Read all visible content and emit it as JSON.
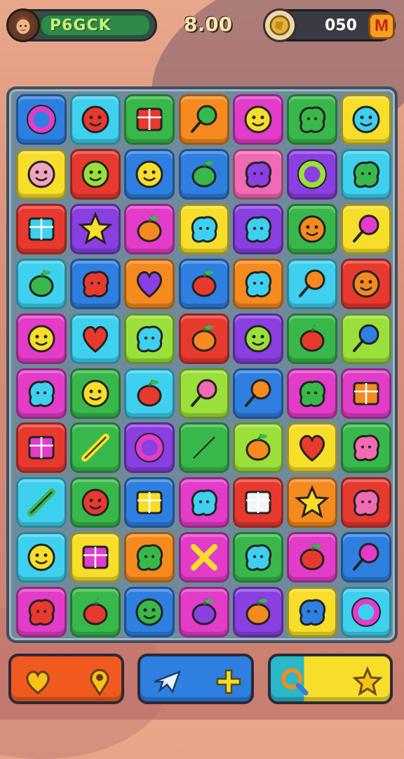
{
  "hud": {
    "player_name": "P6GCK",
    "timer": "8.00",
    "coins": "050",
    "badge_letter": "M"
  },
  "colors": {
    "red": "#e8392f",
    "orange": "#f58a1f",
    "yellow": "#f6de2a",
    "lime": "#9be03a",
    "green": "#38b84a",
    "cyan": "#3ed0ee",
    "blue": "#2e7fe0",
    "purple": "#8a3fe0",
    "magenta": "#e23cc8",
    "pink": "#f06ab4",
    "teal": "#2ab7a9"
  },
  "board": {
    "rows": [
      [
        {
          "bg": "blue",
          "icon": "donut-icon",
          "ic": "#e23cc8"
        },
        {
          "bg": "cyan",
          "icon": "spiky-monster-icon",
          "ic": "#e8392f"
        },
        {
          "bg": "green",
          "icon": "box-icon",
          "ic": "#e8392f"
        },
        {
          "bg": "orange",
          "icon": "lollipop-icon",
          "ic": "#38b84a"
        },
        {
          "bg": "magenta",
          "icon": "cat-face-icon",
          "ic": "#f6de2a"
        },
        {
          "bg": "green",
          "icon": "bush-icon",
          "ic": "#38b84a"
        },
        {
          "bg": "yellow",
          "icon": "blue-critter-icon",
          "ic": "#3ed0ee"
        }
      ],
      [
        {
          "bg": "yellow",
          "icon": "pink-face-icon",
          "ic": "#f3a3c0"
        },
        {
          "bg": "red",
          "icon": "smiley-icon",
          "ic": "#9be03a"
        },
        {
          "bg": "blue",
          "icon": "sun-face-icon",
          "ic": "#f6de2a"
        },
        {
          "bg": "blue",
          "icon": "cucumber-icon",
          "ic": "#38b84a"
        },
        {
          "bg": "pink",
          "icon": "bird-icon",
          "ic": "#8a3fe0"
        },
        {
          "bg": "purple",
          "icon": "ring-icon",
          "ic": "#9be03a"
        },
        {
          "bg": "cyan",
          "icon": "green-blob-icon",
          "ic": "#38b84a"
        }
      ],
      [
        {
          "bg": "red",
          "icon": "safe-icon",
          "ic": "#3ed0ee"
        },
        {
          "bg": "purple",
          "icon": "star-icon",
          "ic": "#f6de2a"
        },
        {
          "bg": "magenta",
          "icon": "orange-fruit-icon",
          "ic": "#f58a1f"
        },
        {
          "bg": "yellow",
          "icon": "blue-cloud-icon",
          "ic": "#3ed0ee"
        },
        {
          "bg": "purple",
          "icon": "blue-splash-icon",
          "ic": "#3ed0ee"
        },
        {
          "bg": "green",
          "icon": "sun-face-icon",
          "ic": "#f58a1f"
        },
        {
          "bg": "yellow",
          "icon": "bomb-icon",
          "ic": "#e23cc8"
        }
      ],
      [
        {
          "bg": "cyan",
          "icon": "pear-icon",
          "ic": "#38b84a"
        },
        {
          "bg": "blue",
          "icon": "lips-icon",
          "ic": "#e8392f"
        },
        {
          "bg": "orange",
          "icon": "heart-fruit-icon",
          "ic": "#8a3fe0"
        },
        {
          "bg": "blue",
          "icon": "spiky-fruit-icon",
          "ic": "#e8392f"
        },
        {
          "bg": "orange",
          "icon": "blue-toy-icon",
          "ic": "#3ed0ee"
        },
        {
          "bg": "cyan",
          "icon": "orange-lollipop-icon",
          "ic": "#f58a1f"
        },
        {
          "bg": "red",
          "icon": "monster-face-icon",
          "ic": "#f58a1f"
        }
      ],
      [
        {
          "bg": "magenta",
          "icon": "yellow-face-icon",
          "ic": "#f6de2a"
        },
        {
          "bg": "cyan",
          "icon": "heart-key-icon",
          "ic": "#e8392f"
        },
        {
          "bg": "lime",
          "icon": "ghost-icon",
          "ic": "#3ed0ee"
        },
        {
          "bg": "red",
          "icon": "orange-slice-icon",
          "ic": "#f58a1f"
        },
        {
          "bg": "purple",
          "icon": "smiley-icon",
          "ic": "#9be03a"
        },
        {
          "bg": "green",
          "icon": "tomato-icon",
          "ic": "#e8392f"
        },
        {
          "bg": "lime",
          "icon": "blue-lollipop-icon",
          "ic": "#2e7fe0"
        }
      ],
      [
        {
          "bg": "magenta",
          "icon": "blue-bubble-icon",
          "ic": "#3ed0ee"
        },
        {
          "bg": "green",
          "icon": "smiley-icon",
          "ic": "#f6de2a"
        },
        {
          "bg": "cyan",
          "icon": "chili-icon",
          "ic": "#e8392f"
        },
        {
          "bg": "lime",
          "icon": "pink-balloon-icon",
          "ic": "#f06ab4"
        },
        {
          "bg": "blue",
          "icon": "shovel-icon",
          "ic": "#f58a1f"
        },
        {
          "bg": "magenta",
          "icon": "lettuce-icon",
          "ic": "#38b84a"
        },
        {
          "bg": "magenta",
          "icon": "orange-box-icon",
          "ic": "#f58a1f"
        }
      ],
      [
        {
          "bg": "red",
          "icon": "flag-icon",
          "ic": "#e23cc8"
        },
        {
          "bg": "green",
          "icon": "taco-icon",
          "ic": "#f6de2a"
        },
        {
          "bg": "purple",
          "icon": "donut-icon",
          "ic": "#e23cc8"
        },
        {
          "bg": "green",
          "icon": "leaf-icon",
          "ic": "#38b84a"
        },
        {
          "bg": "lime",
          "icon": "carrot-icon",
          "ic": "#f58a1f"
        },
        {
          "bg": "yellow",
          "icon": "heart-icon",
          "ic": "#e8392f"
        },
        {
          "bg": "green",
          "icon": "candy-icon",
          "ic": "#f06ab4"
        }
      ],
      [
        {
          "bg": "cyan",
          "icon": "crayon-icon",
          "ic": "#38b84a"
        },
        {
          "bg": "green",
          "icon": "red-monster-icon",
          "ic": "#e8392f"
        },
        {
          "bg": "blue",
          "icon": "letters-icon",
          "ic": "#f6de2a"
        },
        {
          "bg": "magenta",
          "icon": "blue-blob-icon",
          "ic": "#3ed0ee"
        },
        {
          "bg": "red",
          "icon": "cake-icon",
          "ic": "#f4f4f4"
        },
        {
          "bg": "orange",
          "icon": "flower-icon",
          "ic": "#f6de2a"
        },
        {
          "bg": "red",
          "icon": "pink-blob-icon",
          "ic": "#f06ab4"
        }
      ],
      [
        {
          "bg": "cyan",
          "icon": "yellow-face-icon",
          "ic": "#f6de2a"
        },
        {
          "bg": "yellow",
          "icon": "letters-icon",
          "ic": "#e23cc8"
        },
        {
          "bg": "orange",
          "icon": "green-bubble-icon",
          "ic": "#38b84a"
        },
        {
          "bg": "magenta",
          "icon": "cross-icon",
          "ic": "#f6de2a"
        },
        {
          "bg": "green",
          "icon": "blue-bird-icon",
          "ic": "#3ed0ee"
        },
        {
          "bg": "magenta",
          "icon": "apple-icon",
          "ic": "#e8392f"
        },
        {
          "bg": "blue",
          "icon": "purple-lollipop-icon",
          "ic": "#e23cc8"
        }
      ],
      [
        {
          "bg": "magenta",
          "icon": "red-shell-icon",
          "ic": "#e8392f"
        },
        {
          "bg": "green",
          "icon": "red-ball-icon",
          "ic": "#e8392f"
        },
        {
          "bg": "blue",
          "icon": "green-frog-icon",
          "ic": "#38b84a"
        },
        {
          "bg": "magenta",
          "icon": "eggplant-icon",
          "ic": "#8a3fe0"
        },
        {
          "bg": "purple",
          "icon": "orange-bug-icon",
          "ic": "#f58a1f"
        },
        {
          "bg": "yellow",
          "icon": "blue-candy-icon",
          "ic": "#2e7fe0"
        },
        {
          "bg": "cyan",
          "icon": "camera-icon",
          "ic": "#e23cc8"
        }
      ]
    ]
  },
  "actions": [
    {
      "name": "hearts-button",
      "bg": "#f05a1e",
      "icons": [
        "heart-icon",
        "location-pin-icon"
      ]
    },
    {
      "name": "boost-button",
      "bg": "#2e7fe0",
      "icons": [
        "plane-icon",
        "plus-icon"
      ]
    },
    {
      "name": "search-star-button",
      "bg": "#f6de2a",
      "icons": [
        "magnifier-icon",
        "star-icon"
      ]
    }
  ]
}
